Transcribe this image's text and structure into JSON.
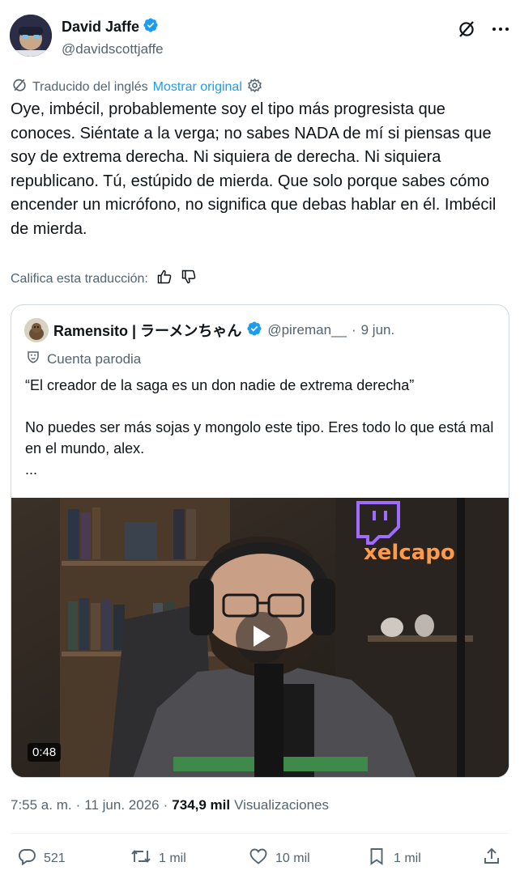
{
  "author": {
    "display_name": "David Jaffe",
    "handle": "@davidscottjaffe"
  },
  "header_icons": [
    "grok-icon",
    "more-icon"
  ],
  "translation": {
    "label": "Traducido del inglés",
    "show_original": "Mostrar original"
  },
  "tweet": {
    "text": "Oye, imbécil, probablemente soy el tipo más progresista que conoces. Siéntate a la verga; no sabes NADA de mí si piensas que soy de extrema derecha. Ni siquiera de derecha. Ni siquiera republicano. Tú, estúpido de mierda. Que solo porque sabes cómo encender un micrófono, no significa que debas hablar en él. Imbécil de mierda."
  },
  "rate_translation": {
    "label": "Califica esta traducción:"
  },
  "quoted": {
    "display_name": "Ramensito | ラーメンちゃん",
    "handle": "@pireman__",
    "separator": "·",
    "date": "9 jun.",
    "parody_label": "Cuenta parodia",
    "lines": [
      "“El creador de la saga es un don nadie de extrema derecha”",
      "",
      "No puedes ser más sojas y mongolo este tipo. Eres todo lo que está mal en el mundo, alex.",
      "..."
    ],
    "video": {
      "duration": "0:48",
      "neon_text": "xelcapo"
    }
  },
  "meta": {
    "time": "7:55 a. m.",
    "dot1": "·",
    "date": "11 jun. 2026",
    "dot2": "·",
    "views_count": "734,9 mil",
    "views_label": "Visualizaciones"
  },
  "actions": {
    "replies": "521",
    "reposts": "1 mil",
    "likes": "10 mil",
    "bookmarks": "1 mil"
  },
  "colors": {
    "accent": "#1d9bf0",
    "text": "#0f1419",
    "secondary": "#536471",
    "border": "#cfd9de"
  }
}
